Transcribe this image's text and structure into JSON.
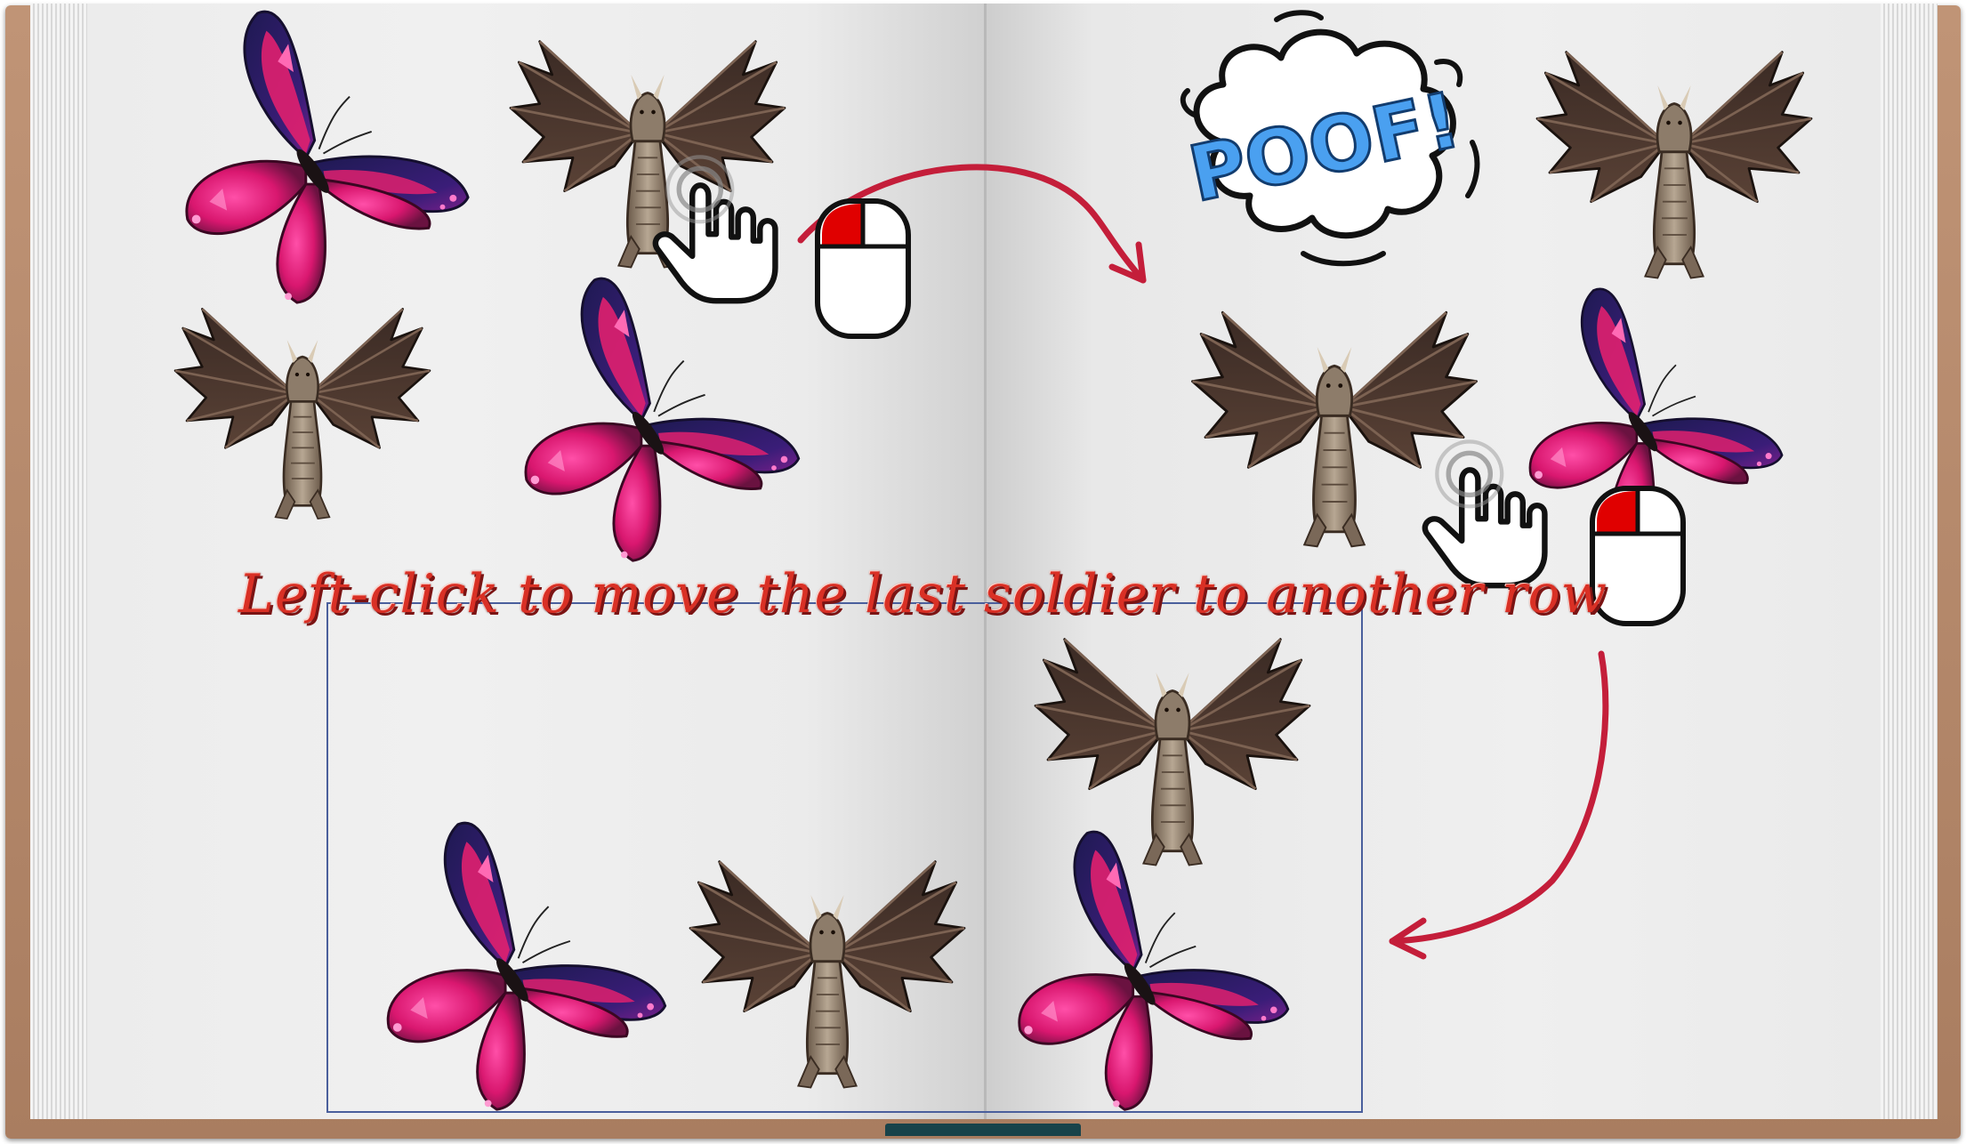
{
  "scene": {
    "instruction": "Left-click to move the last soldier to another row",
    "effect_text": "POOF!"
  },
  "colors": {
    "instruction": "#d93025",
    "arrow": "#c41e3a",
    "poof_text": "#4aa0f0",
    "mouse_button": "#e00000",
    "arena_border": "#4a5f9c",
    "book_cover": "#b08568"
  },
  "units": [
    {
      "type": "butterfly"
    },
    {
      "type": "dragon"
    },
    {
      "type": "dragon"
    },
    {
      "type": "butterfly"
    },
    {
      "type": "dragon"
    },
    {
      "type": "dragon"
    },
    {
      "type": "butterfly"
    },
    {
      "type": "dragon"
    },
    {
      "type": "butterfly"
    },
    {
      "type": "dragon"
    },
    {
      "type": "butterfly"
    }
  ],
  "icons": [
    "hand-pointer-icon",
    "mouse-left-click-icon",
    "curved-arrow-icon",
    "poof-burst-icon"
  ]
}
